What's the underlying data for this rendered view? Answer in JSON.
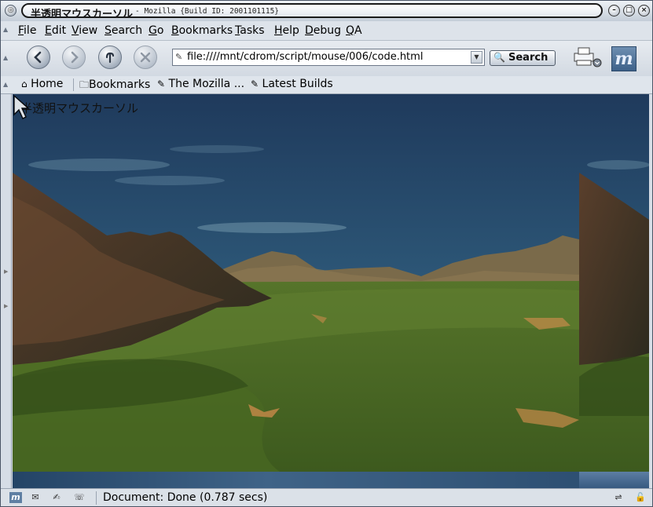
{
  "window": {
    "title": "半透明マウスカーソル",
    "title_suffix": "- Mozilla {Build ID: 2001101115}"
  },
  "menu": [
    "File",
    "Edit",
    "View",
    "Search",
    "Go",
    "Bookmarks",
    "Tasks",
    "Help",
    "Debug",
    "QA"
  ],
  "menu_access_keys": [
    "F",
    "E",
    "V",
    "S",
    "G",
    "B",
    "T",
    "H",
    "D",
    "Q"
  ],
  "nav": {
    "url": "file:////mnt/cdrom/script/mouse/006/code.html",
    "search_label": "Search"
  },
  "personal_toolbar": {
    "home": "Home",
    "bookmarks": "Bookmarks",
    "item1": "The Mozilla ...",
    "item2": "Latest Builds"
  },
  "page": {
    "heading": "半透明マウスカーソル"
  },
  "status": {
    "text": "Document: Done (0.787 secs)"
  },
  "icons": [
    "back-icon",
    "forward-icon",
    "reload-icon",
    "stop-icon",
    "print-icon",
    "mozilla-logo-icon",
    "home-icon",
    "folder-icon",
    "bookmark-icon",
    "mail-icon",
    "composer-icon",
    "chat-icon",
    "connection-icon",
    "security-lock-icon",
    "cursor-arrow-icon"
  ]
}
